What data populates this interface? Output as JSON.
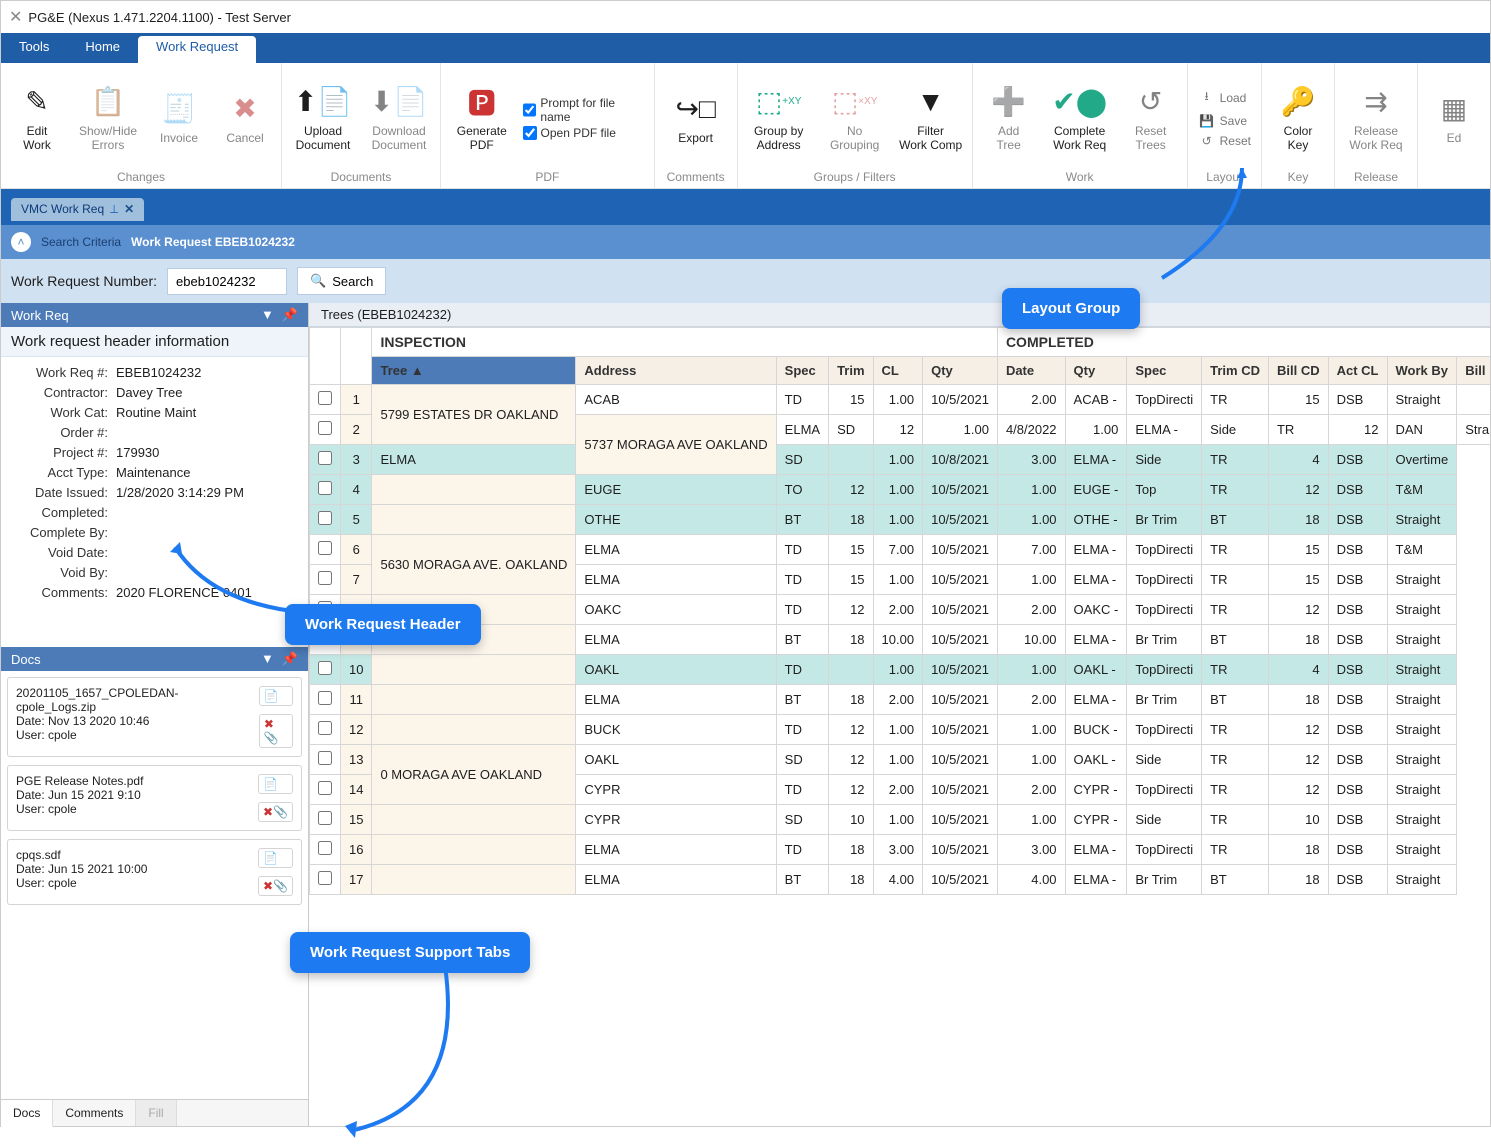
{
  "window": {
    "title": "PG&E (Nexus 1.471.2204.1100) - Test Server"
  },
  "menu": {
    "tools": "Tools",
    "home": "Home",
    "work_request": "Work Request"
  },
  "ribbon": {
    "changes": {
      "label": "Changes",
      "edit": "Edit\nWork",
      "showhide": "Show/Hide\nErrors",
      "invoice": "Invoice",
      "cancel": "Cancel"
    },
    "documents": {
      "label": "Documents",
      "upload": "Upload\nDocument",
      "download": "Download\nDocument"
    },
    "pdf": {
      "label": "PDF",
      "generate": "Generate\nPDF",
      "prompt": "Prompt for file name",
      "open": "Open PDF file"
    },
    "comments": {
      "label": "Comments",
      "export": "Export"
    },
    "groups": {
      "label": "Groups / Filters",
      "groupby": "Group by\nAddress",
      "nogroup": "No\nGrouping",
      "filter": "Filter\nWork Comp"
    },
    "work": {
      "label": "Work",
      "addtree": "Add\nTree",
      "complete": "Complete\nWork Req",
      "reset": "Reset\nTrees"
    },
    "layout": {
      "label": "Layout",
      "load": "Load",
      "save": "Save",
      "reset": "Reset"
    },
    "key": {
      "label": "Key",
      "colorkey": "Color\nKey"
    },
    "release": {
      "label": "Release",
      "release": "Release\nWork Req"
    },
    "extra": {
      "ed": "Ed"
    }
  },
  "crumb": {
    "tab": "VMC Work Req"
  },
  "searchhdr": {
    "criteria": "Search Criteria",
    "title": "Work Request EBEB1024232"
  },
  "searchrow": {
    "label": "Work Request Number:",
    "value": "ebeb1024232",
    "btn": "Search"
  },
  "panel": {
    "header": "Work Req",
    "info": "Work request header information",
    "kv": [
      {
        "k": "Work Req #:",
        "v": "EBEB1024232"
      },
      {
        "k": "Contractor:",
        "v": "Davey Tree"
      },
      {
        "k": "Work Cat:",
        "v": "Routine Maint"
      },
      {
        "k": "Order #:",
        "v": ""
      },
      {
        "k": "Project #:",
        "v": "179930"
      },
      {
        "k": "Acct Type:",
        "v": "Maintenance"
      },
      {
        "k": "Date Issued:",
        "v": "1/28/2020 3:14:29 PM"
      },
      {
        "k": "Completed:",
        "v": ""
      },
      {
        "k": "Complete By:",
        "v": ""
      },
      {
        "k": "Void Date:",
        "v": ""
      },
      {
        "k": "Void By:",
        "v": ""
      },
      {
        "k": "Comments:",
        "v": "2020 FLORENCE 0401"
      }
    ]
  },
  "docs": {
    "header": "Docs",
    "items": [
      {
        "name": "20201105_1657_CPOLEDAN-cpole_Logs.zip",
        "date": "Date: Nov 13 2020 10:46",
        "user": "User:  cpole"
      },
      {
        "name": "PGE Release Notes.pdf",
        "date": "Date: Jun 15 2021 9:10",
        "user": "User:  cpole"
      },
      {
        "name": "cpqs.sdf",
        "date": "Date: Jun 15 2021 10:00",
        "user": "User:  cpole"
      }
    ],
    "tabs": {
      "docs": "Docs",
      "comments": "Comments",
      "fill": "Fill"
    }
  },
  "grid": {
    "tab": "Trees (EBEB1024232)",
    "group1": "INSPECTION",
    "group2": "COMPLETED",
    "cols": {
      "tree": "Tree",
      "address": "Address",
      "spec": "Spec",
      "trim": "Trim",
      "cl": "CL",
      "qty": "Qty",
      "date": "Date",
      "qty2": "Qty",
      "spec2": "Spec",
      "trimcd": "Trim CD",
      "billcd": "Bill CD",
      "actcl": "Act CL",
      "workby": "Work By",
      "billrate": "Bill Rate"
    },
    "rows": [
      {
        "hl": false,
        "idx": "1",
        "addr": "5799 ESTATES DR OAKLAND",
        "as": 2,
        "spec": "ACAB",
        "trim": "TD",
        "cl": "15",
        "qty": "1.00",
        "date": "10/5/2021",
        "qty2": "2.00",
        "spec2": "ACAB -",
        "trimcd": "TopDirecti",
        "billcd": "TR",
        "actcl": "15",
        "workby": "DSB",
        "billrate": "Straight"
      },
      {
        "hl": false,
        "idx": "2",
        "addr": "5737 MORAGA AVE OAKLAND",
        "as": 2,
        "spec": "ELMA",
        "trim": "SD",
        "cl": "12",
        "qty": "1.00",
        "date": "4/8/2022",
        "qty2": "1.00",
        "spec2": "ELMA -",
        "trimcd": "Side",
        "billcd": "TR",
        "actcl": "12",
        "workby": "DAN",
        "billrate": "Straight"
      },
      {
        "hl": true,
        "idx": "3",
        "addr": "",
        "as": 0,
        "spec": "ELMA",
        "trim": "SD",
        "cl": "",
        "qty": "1.00",
        "date": "10/8/2021",
        "qty2": "3.00",
        "spec2": "ELMA -",
        "trimcd": "Side",
        "billcd": "TR",
        "actcl": "4",
        "workby": "DSB",
        "billrate": "Overtime"
      },
      {
        "hl": true,
        "idx": "4",
        "addr": "",
        "as": 0,
        "spec": "EUGE",
        "trim": "TO",
        "cl": "12",
        "qty": "1.00",
        "date": "10/5/2021",
        "qty2": "1.00",
        "spec2": "EUGE -",
        "trimcd": "Top",
        "billcd": "TR",
        "actcl": "12",
        "workby": "DSB",
        "billrate": "T&M"
      },
      {
        "hl": true,
        "idx": "5",
        "addr": "",
        "as": 0,
        "spec": "OTHE",
        "trim": "BT",
        "cl": "18",
        "qty": "1.00",
        "date": "10/5/2021",
        "qty2": "1.00",
        "spec2": "OTHE -",
        "trimcd": "Br Trim",
        "billcd": "BT",
        "actcl": "18",
        "workby": "DSB",
        "billrate": "Straight"
      },
      {
        "hl": false,
        "idx": "6",
        "addr": "5630 MORAGA AVE. OAKLAND",
        "as": 2,
        "spec": "ELMA",
        "trim": "TD",
        "cl": "15",
        "qty": "7.00",
        "date": "10/5/2021",
        "qty2": "7.00",
        "spec2": "ELMA -",
        "trimcd": "TopDirecti",
        "billcd": "TR",
        "actcl": "15",
        "workby": "DSB",
        "billrate": "T&M"
      },
      {
        "hl": false,
        "idx": "7",
        "addr": "",
        "as": 0,
        "spec": "ELMA",
        "trim": "TD",
        "cl": "15",
        "qty": "1.00",
        "date": "10/5/2021",
        "qty2": "1.00",
        "spec2": "ELMA -",
        "trimcd": "TopDirecti",
        "billcd": "TR",
        "actcl": "15",
        "workby": "DSB",
        "billrate": "Straight"
      },
      {
        "hl": false,
        "idx": "8",
        "addr": "",
        "as": 0,
        "spec": "OAKC",
        "trim": "TD",
        "cl": "12",
        "qty": "2.00",
        "date": "10/5/2021",
        "qty2": "2.00",
        "spec2": "OAKC -",
        "trimcd": "TopDirecti",
        "billcd": "TR",
        "actcl": "12",
        "workby": "DSB",
        "billrate": "Straight"
      },
      {
        "hl": false,
        "idx": "9",
        "addr": "",
        "as": 0,
        "spec": "ELMA",
        "trim": "BT",
        "cl": "18",
        "qty": "10.00",
        "date": "10/5/2021",
        "qty2": "10.00",
        "spec2": "ELMA -",
        "trimcd": "Br Trim",
        "billcd": "BT",
        "actcl": "18",
        "workby": "DSB",
        "billrate": "Straight"
      },
      {
        "hl": true,
        "idx": "10",
        "addr": "",
        "as": 0,
        "spec": "OAKL",
        "trim": "TD",
        "cl": "",
        "qty": "1.00",
        "date": "10/5/2021",
        "qty2": "1.00",
        "spec2": "OAKL -",
        "trimcd": "TopDirecti",
        "billcd": "TR",
        "actcl": "4",
        "workby": "DSB",
        "billrate": "Straight"
      },
      {
        "hl": false,
        "idx": "11",
        "addr": "",
        "as": 0,
        "spec": "ELMA",
        "trim": "BT",
        "cl": "18",
        "qty": "2.00",
        "date": "10/5/2021",
        "qty2": "2.00",
        "spec2": "ELMA -",
        "trimcd": "Br Trim",
        "billcd": "BT",
        "actcl": "18",
        "workby": "DSB",
        "billrate": "Straight"
      },
      {
        "hl": false,
        "idx": "12",
        "addr": "",
        "as": 0,
        "spec": "BUCK",
        "trim": "TD",
        "cl": "12",
        "qty": "1.00",
        "date": "10/5/2021",
        "qty2": "1.00",
        "spec2": "BUCK -",
        "trimcd": "TopDirecti",
        "billcd": "TR",
        "actcl": "12",
        "workby": "DSB",
        "billrate": "Straight"
      },
      {
        "hl": false,
        "idx": "13",
        "addr": "0 MORAGA AVE OAKLAND",
        "as": 2,
        "spec": "OAKL",
        "trim": "SD",
        "cl": "12",
        "qty": "1.00",
        "date": "10/5/2021",
        "qty2": "1.00",
        "spec2": "OAKL -",
        "trimcd": "Side",
        "billcd": "TR",
        "actcl": "12",
        "workby": "DSB",
        "billrate": "Straight"
      },
      {
        "hl": false,
        "idx": "14",
        "addr": "",
        "as": 0,
        "spec": "CYPR",
        "trim": "TD",
        "cl": "12",
        "qty": "2.00",
        "date": "10/5/2021",
        "qty2": "2.00",
        "spec2": "CYPR -",
        "trimcd": "TopDirecti",
        "billcd": "TR",
        "actcl": "12",
        "workby": "DSB",
        "billrate": "Straight"
      },
      {
        "hl": false,
        "idx": "15",
        "addr": "",
        "as": 0,
        "spec": "CYPR",
        "trim": "SD",
        "cl": "10",
        "qty": "1.00",
        "date": "10/5/2021",
        "qty2": "1.00",
        "spec2": "CYPR -",
        "trimcd": "Side",
        "billcd": "TR",
        "actcl": "10",
        "workby": "DSB",
        "billrate": "Straight"
      },
      {
        "hl": false,
        "idx": "16",
        "addr": "",
        "as": 0,
        "spec": "ELMA",
        "trim": "TD",
        "cl": "18",
        "qty": "3.00",
        "date": "10/5/2021",
        "qty2": "3.00",
        "spec2": "ELMA -",
        "trimcd": "TopDirecti",
        "billcd": "TR",
        "actcl": "18",
        "workby": "DSB",
        "billrate": "Straight"
      },
      {
        "hl": false,
        "idx": "17",
        "addr": "",
        "as": 0,
        "spec": "ELMA",
        "trim": "BT",
        "cl": "18",
        "qty": "4.00",
        "date": "10/5/2021",
        "qty2": "4.00",
        "spec2": "ELMA -",
        "trimcd": "Br Trim",
        "billcd": "BT",
        "actcl": "18",
        "workby": "DSB",
        "billrate": "Straight"
      }
    ]
  },
  "callouts": {
    "layout": "Layout Group",
    "header": "Work Request Header",
    "tabs": "Work Request Support Tabs"
  }
}
